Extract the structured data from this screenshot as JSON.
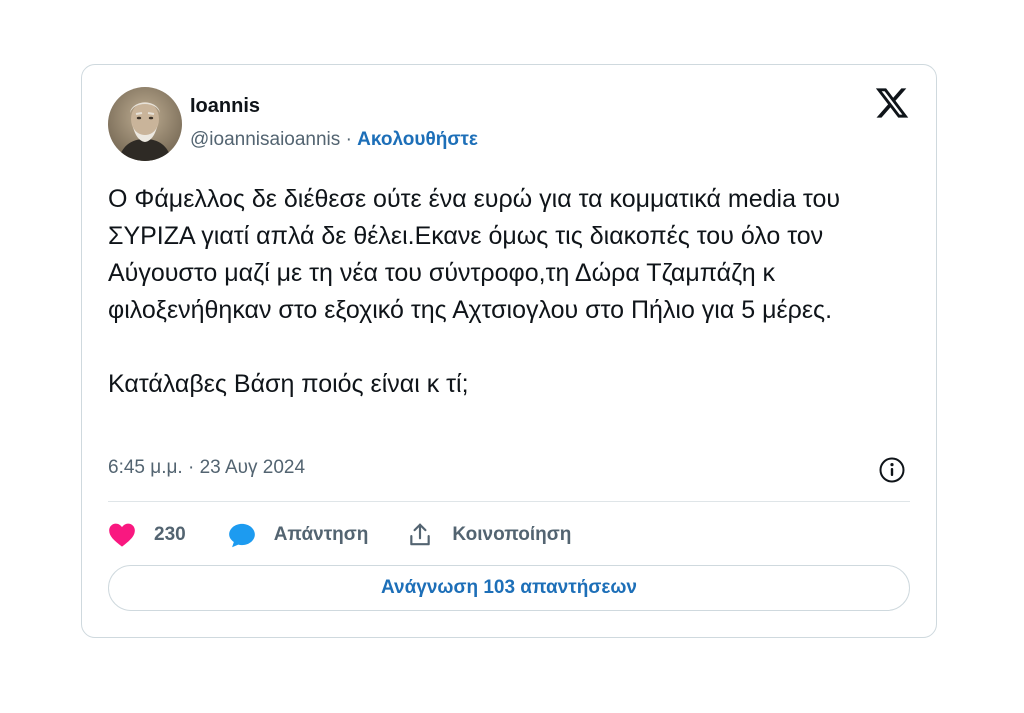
{
  "author": {
    "name": "Ioannis",
    "handle": "@ioannisaioannis",
    "separator": "·",
    "follow_label": "Ακολουθήστε"
  },
  "tweet": {
    "paragraphs": [
      "Ο Φάμελλος δε διέθεσε ούτε ένα ευρώ για τα κομματικά media του ΣΥΡΙΖΑ γιατί απλά δε θέλει.Εκανε όμως τις διακοπές του όλο τον Αύγουστο μαζί με τη νέα του σύντροφο,τη Δώρα Τζαμπάζη κ φιλοξενήθηκαν στο εξοχικό της Αχτσιογλου στο Πήλιο για 5 μέρες.",
      "Κατάλαβες Βάση ποιός είναι κ τί;"
    ],
    "timestamp": "6:45 μ.μ. · 23 Αυγ 2024"
  },
  "actions": {
    "likes_count": "230",
    "reply_label": "Απάντηση",
    "share_label": "Κοινοποίηση"
  },
  "read_replies_label": "Ανάγνωση 103 απαντήσεων",
  "icons": {
    "brand": "x-logo-icon",
    "info": "info-icon",
    "like": "heart-icon",
    "reply": "speech-bubble-icon",
    "share": "share-upload-icon"
  },
  "colors": {
    "heart": "#f91880",
    "reply_bubble": "#1d9bf0",
    "link_blue": "#1d6fb8",
    "secondary_text": "#536471",
    "primary_text": "#0f1419",
    "border": "#cfd9de"
  }
}
